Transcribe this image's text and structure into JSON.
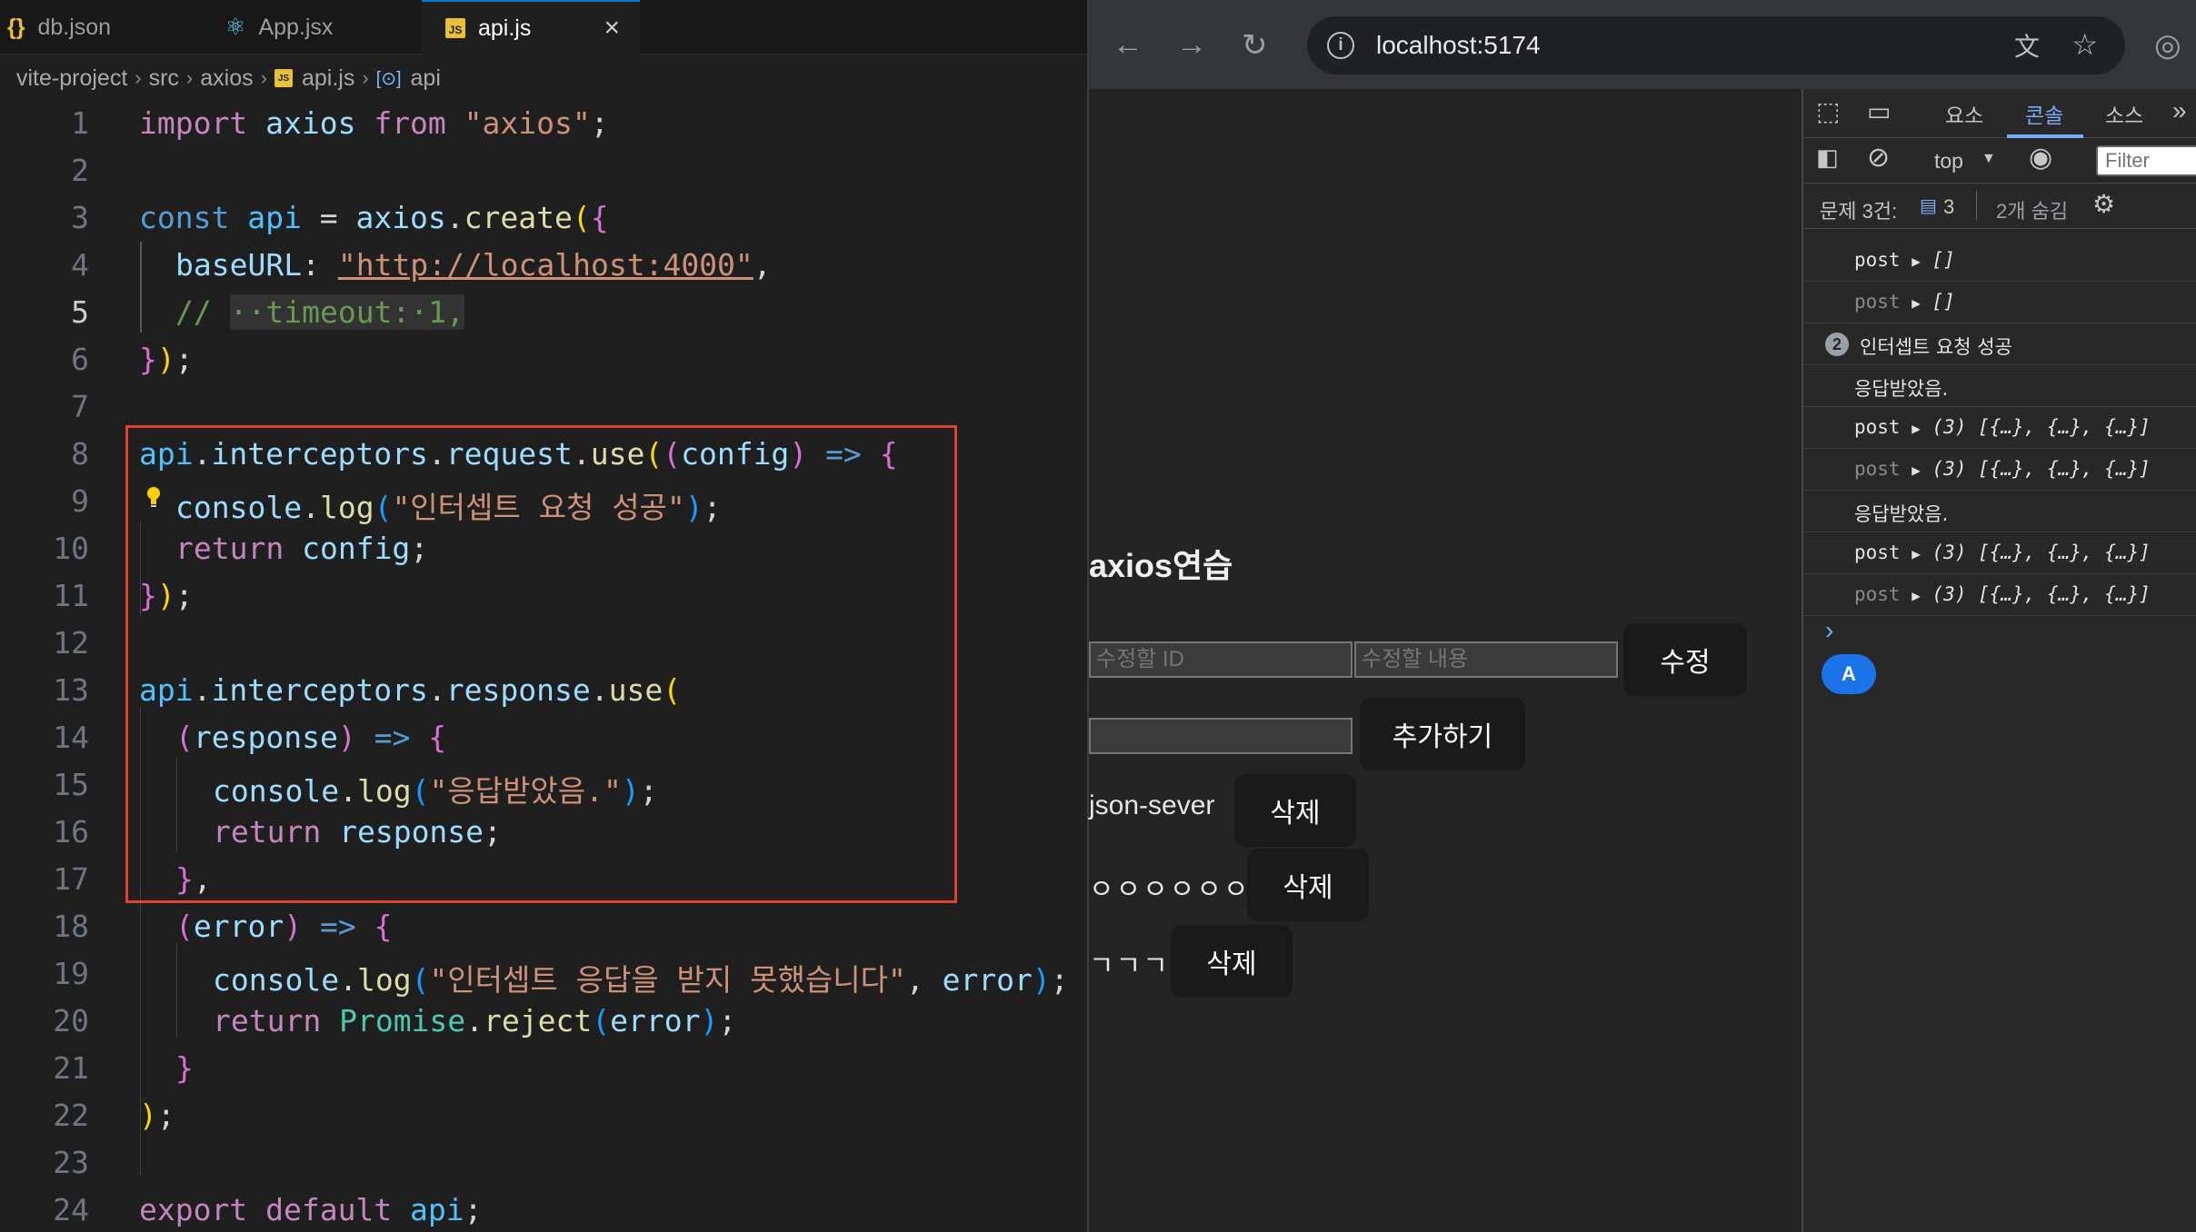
{
  "editor": {
    "tabs": [
      {
        "icon": "{}",
        "label": "db.json"
      },
      {
        "icon": "⚛",
        "label": "App.jsx"
      },
      {
        "icon": "JS",
        "label": "api.js",
        "close": "×"
      }
    ],
    "breadcrumb": [
      "vite-project",
      "src",
      "axios",
      "api.js",
      "api"
    ],
    "line_numbers": [
      "1",
      "2",
      "3",
      "4",
      "5",
      "6",
      "7",
      "8",
      "9",
      "10",
      "11",
      "12",
      "13",
      "14",
      "15",
      "16",
      "17",
      "18",
      "19",
      "20",
      "21",
      "22",
      "23",
      "24"
    ],
    "code": {
      "l1": [
        "import",
        "axios",
        "from",
        "\"axios\"",
        ";"
      ],
      "l3": [
        "const",
        "api",
        "=",
        "axios",
        ".",
        "create",
        "(",
        "{"
      ],
      "l4": [
        "baseURL",
        ":",
        "\"http://localhost:4000\"",
        ","
      ],
      "l5": [
        "//",
        "··timeout:·1,"
      ],
      "l6": [
        "}",
        ")",
        ";"
      ],
      "l8": [
        "api",
        ".",
        "interceptors",
        ".",
        "request",
        ".",
        "use",
        "(",
        "(",
        "config",
        ")",
        "=>",
        "{"
      ],
      "l9": [
        "console",
        ".",
        "log",
        "(",
        "\"인터셉트 요청 성공\"",
        ")",
        ";"
      ],
      "l10": [
        "return",
        "config",
        ";"
      ],
      "l11": [
        "}",
        ")",
        ";"
      ],
      "l13": [
        "api",
        ".",
        "interceptors",
        ".",
        "response",
        ".",
        "use",
        "("
      ],
      "l14": [
        "(",
        "response",
        ")",
        "=>",
        "{"
      ],
      "l15": [
        "console",
        ".",
        "log",
        "(",
        "\"응답받았음.\"",
        ")",
        ";"
      ],
      "l16": [
        "return",
        "response",
        ";"
      ],
      "l17": [
        "}",
        ","
      ],
      "l18": [
        "(",
        "error",
        ")",
        "=>",
        "{"
      ],
      "l19": [
        "console",
        ".",
        "log",
        "(",
        "\"인터셉트 응답을 받지 못했습니다\"",
        ",",
        "error",
        ")",
        ";"
      ],
      "l20": [
        "return",
        "Promise",
        ".",
        "reject",
        "(",
        "error",
        ")",
        ";"
      ],
      "l21": [
        "}"
      ],
      "l22": [
        ")",
        ";"
      ],
      "l24": [
        "export",
        "default",
        "api",
        ";"
      ]
    }
  },
  "browser": {
    "url": "localhost:5174",
    "page": {
      "heading": "axios연습",
      "edit_id_placeholder": "수정할 ID",
      "edit_content_placeholder": "수정할 내용",
      "edit_button": "수정",
      "add_button": "추가하기",
      "items": [
        {
          "text": "json-sever",
          "button": "삭제"
        },
        {
          "text": "ㅇㅇㅇㅇㅇㅇ",
          "button": "삭제"
        },
        {
          "text": "ㄱㄱㄱ",
          "button": "삭제"
        }
      ]
    }
  },
  "devtools": {
    "tabs": [
      "요소",
      "콘솔",
      "소스"
    ],
    "active_tab": "콘솔",
    "context": "top",
    "filter_placeholder": "Filter",
    "issues_label": "문제 3건:",
    "issues_count": "3",
    "hidden_label": "2개 숨김",
    "console": [
      {
        "label": "post",
        "value": "[]"
      },
      {
        "label": "post",
        "value": "[]"
      },
      {
        "count": "2",
        "message": "인터셉트 요청 성공"
      },
      {
        "message": "응답받았음."
      },
      {
        "label": "post",
        "count": "(3)",
        "value": "[{…}, {…}, {…}]"
      },
      {
        "label": "post",
        "count": "(3)",
        "value": "[{…}, {…}, {…}]"
      },
      {
        "message": "응답받았음."
      },
      {
        "label": "post",
        "count": "(3)",
        "value": "[{…}, {…}, {…}]"
      },
      {
        "label": "post",
        "count": "(3)",
        "value": "[{…}, {…}, {…}]"
      }
    ],
    "prompt": "›",
    "avatar": "A"
  }
}
